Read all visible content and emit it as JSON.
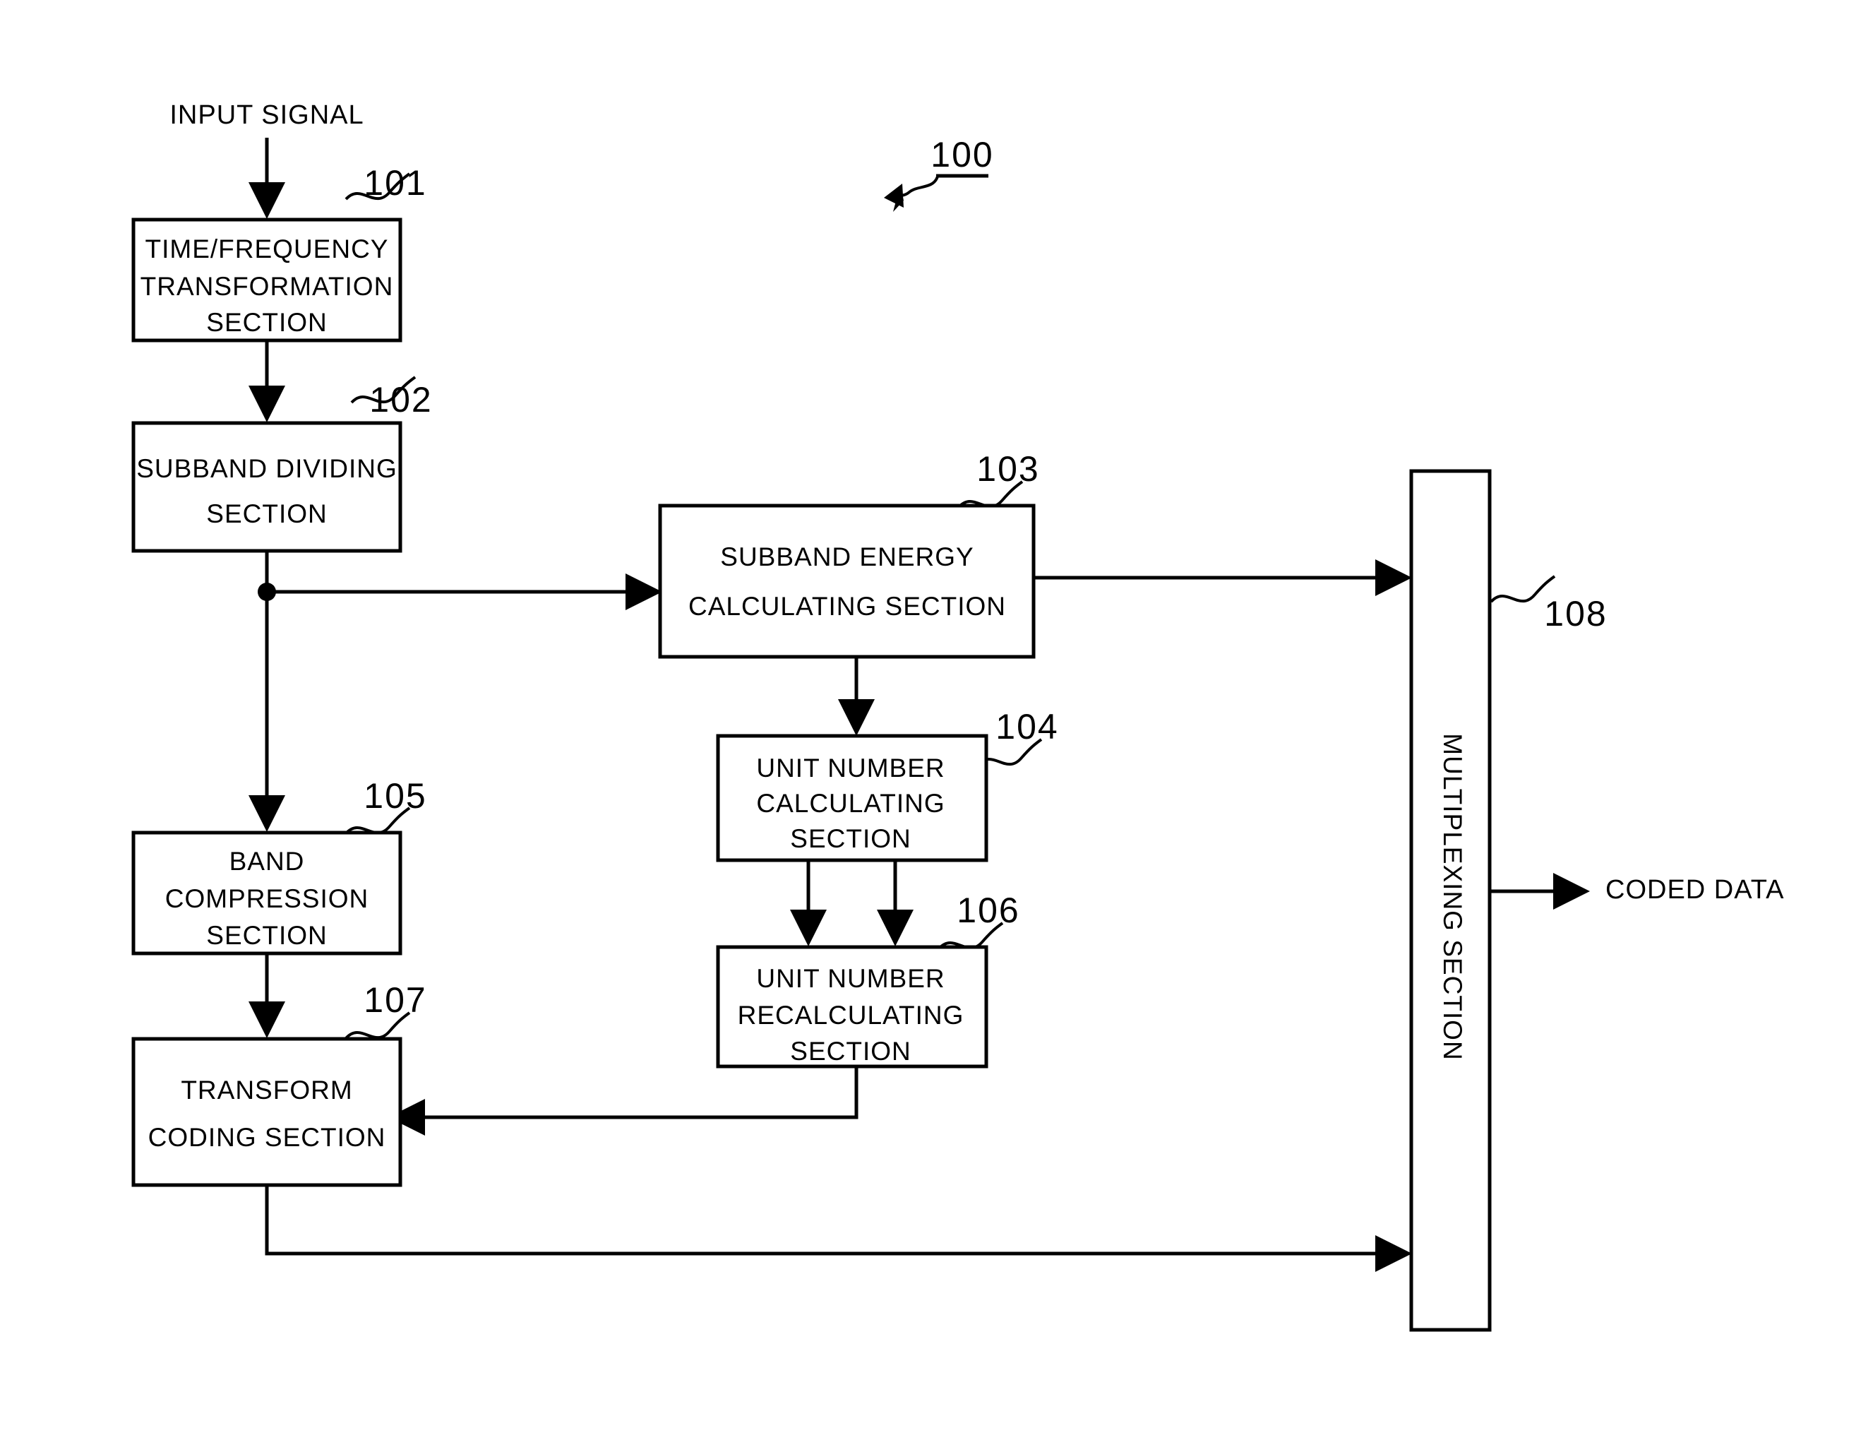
{
  "figure": {
    "reference_numeral": "100",
    "input_label": "INPUT SIGNAL",
    "output_label": "CODED DATA"
  },
  "blocks": [
    {
      "id": "101",
      "ref": "101",
      "lines": [
        "TIME/FREQUENCY",
        "TRANSFORMATION",
        "SECTION"
      ]
    },
    {
      "id": "102",
      "ref": "102",
      "lines": [
        "SUBBAND DIVIDING",
        "SECTION"
      ]
    },
    {
      "id": "103",
      "ref": "103",
      "lines": [
        "SUBBAND ENERGY",
        "CALCULATING SECTION"
      ]
    },
    {
      "id": "104",
      "ref": "104",
      "lines": [
        "UNIT NUMBER",
        "CALCULATING",
        "SECTION"
      ]
    },
    {
      "id": "105",
      "ref": "105",
      "lines": [
        "BAND",
        "COMPRESSION",
        "SECTION"
      ]
    },
    {
      "id": "106",
      "ref": "106",
      "lines": [
        "UNIT NUMBER",
        "RECALCULATING",
        "SECTION"
      ]
    },
    {
      "id": "107",
      "ref": "107",
      "lines": [
        "TRANSFORM",
        "CODING SECTION"
      ]
    },
    {
      "id": "108",
      "ref": "108",
      "lines": [
        "MULTIPLEXING SECTION"
      ]
    }
  ],
  "text": {
    "b101_l1": "TIME/FREQUENCY",
    "b101_l2": "TRANSFORMATION",
    "b101_l3": "SECTION",
    "b101_ref": "101",
    "b102_l1": "SUBBAND DIVIDING",
    "b102_l2": "SECTION",
    "b102_ref": "102",
    "b103_l1": "SUBBAND ENERGY",
    "b103_l2": "CALCULATING SECTION",
    "b103_ref": "103",
    "b104_l1": "UNIT NUMBER",
    "b104_l2": "CALCULATING",
    "b104_l3": "SECTION",
    "b104_ref": "104",
    "b105_l1": "BAND",
    "b105_l2": "COMPRESSION",
    "b105_l3": "SECTION",
    "b105_ref": "105",
    "b106_l1": "UNIT NUMBER",
    "b106_l2": "RECALCULATING",
    "b106_l3": "SECTION",
    "b106_ref": "106",
    "b107_l1": "TRANSFORM",
    "b107_l2": "CODING SECTION",
    "b107_ref": "107",
    "b108_l1": "MULTIPLEXING SECTION",
    "b108_ref": "108",
    "fig_ref": "100",
    "input_signal": "INPUT SIGNAL",
    "coded_data": "CODED DATA"
  },
  "colors": {
    "line": "#000000",
    "background": "#ffffff",
    "box_fill": "#ffffff"
  }
}
